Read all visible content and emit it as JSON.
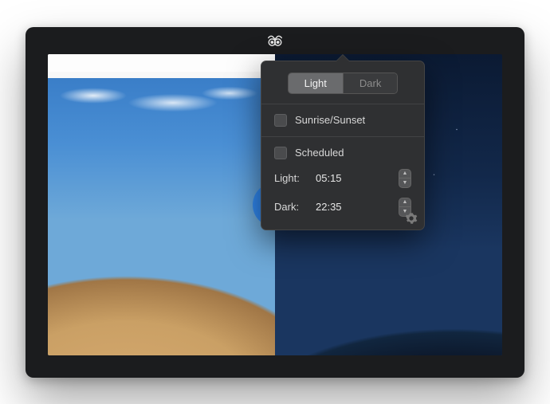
{
  "menubar": {
    "app_icon": "owl-icon"
  },
  "popover": {
    "segmented": {
      "light_label": "Light",
      "dark_label": "Dark",
      "active": "light"
    },
    "sunrise_sunset": {
      "label": "Sunrise/Sunset",
      "checked": false
    },
    "scheduled": {
      "label": "Scheduled",
      "checked": false,
      "light": {
        "label": "Light:",
        "time": "05:15"
      },
      "dark": {
        "label": "Dark:",
        "time": "22:35"
      }
    },
    "settings_icon": "gear-icon"
  }
}
